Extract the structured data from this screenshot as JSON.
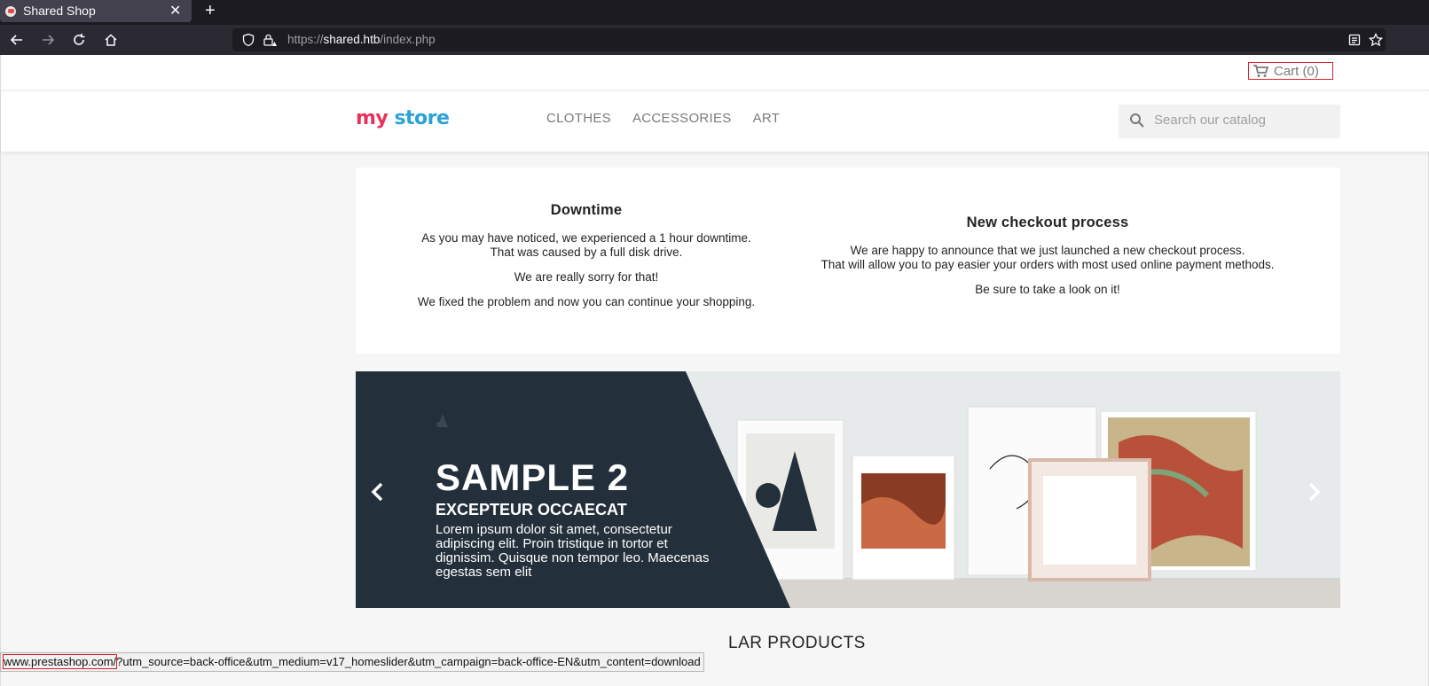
{
  "browser": {
    "tab_title": "Shared Shop",
    "new_tab": "+",
    "url_scheme": "https://",
    "url_host": "shared.htb",
    "url_path": "/index.php"
  },
  "header": {
    "cart_label": "Cart (0)",
    "logo_parts": [
      "my",
      " ",
      "store"
    ],
    "menu": [
      "CLOTHES",
      "ACCESSORIES",
      "ART"
    ],
    "search_placeholder": "Search our catalog"
  },
  "notice": {
    "left": {
      "title": "Downtime",
      "paragraphs": [
        "As you may have noticed, we experienced a 1 hour downtime.\nThat was caused by a full disk drive.",
        "We are really sorry for that!",
        "We fixed the problem and now you can continue your shopping."
      ]
    },
    "right": {
      "title": "New checkout process",
      "paragraphs": [
        "We are happy to announce that we just launched a new checkout process.\nThat will allow you to pay easier your orders with most used online payment methods.",
        "Be sure to take a look on it!"
      ]
    }
  },
  "slider": {
    "title": "SAMPLE 2",
    "subtitle": "EXCEPTEUR OCCAECAT",
    "body": "Lorem ipsum dolor sit amet, consectetur adipiscing elit. Proin tristique in tortor et dignissim. Quisque non tempor leo. Maecenas egestas sem elit"
  },
  "section_title": "LAR PRODUCTS",
  "status_url_prefix": "www.prestashop.com/",
  "status_url_rest": "?utm_source=back-office&utm_medium=v17_homeslider&utm_campaign=back-office-EN&utm_content=download",
  "colors": {
    "accent_red": "#d9232e",
    "slide_dark": "#232f3a"
  }
}
